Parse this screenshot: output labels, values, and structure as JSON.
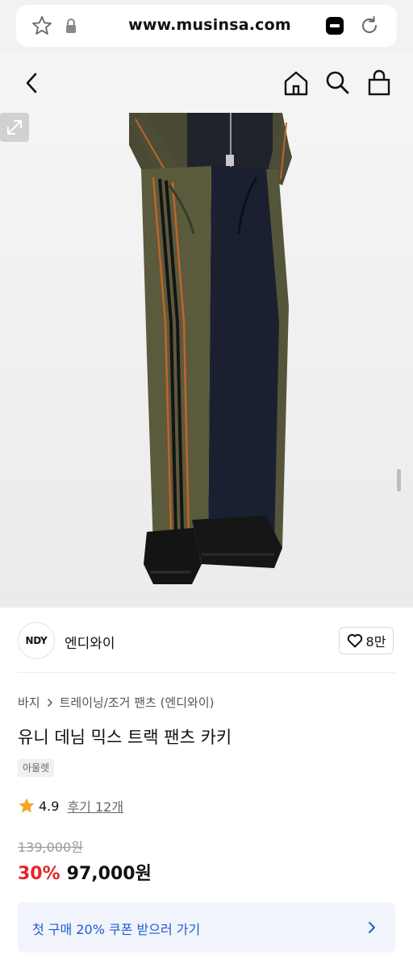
{
  "browser": {
    "url": "www.musinsa.com",
    "icons": [
      "star-icon",
      "lock-icon",
      "site-logo-icon",
      "reload-icon"
    ]
  },
  "header": {
    "icons": [
      "back-icon",
      "home-icon",
      "search-icon",
      "bag-icon"
    ]
  },
  "brand": {
    "logo_text": "NDY",
    "name": "엔디와이",
    "like_count": "8만"
  },
  "product": {
    "breadcrumb": [
      "바지",
      "트레이닝/조거 팬츠 (엔디와이)"
    ],
    "title": "유니 데님 믹스 트랙 팬츠 카키",
    "tag": "아울렛",
    "rating": "4.9",
    "review_link": "후기 12개",
    "original_price": "139,000원",
    "discount": "30%",
    "sale_price": "97,000원"
  },
  "coupon": {
    "text": "첫 구매 20% 쿠폰 받으러 가기"
  },
  "colors": {
    "discount_red": "#e3262b",
    "coupon_blue": "#1f5bd6",
    "rating_star": "#f5a623",
    "khaki": "#5a5a3c",
    "navy": "#1b2030"
  }
}
